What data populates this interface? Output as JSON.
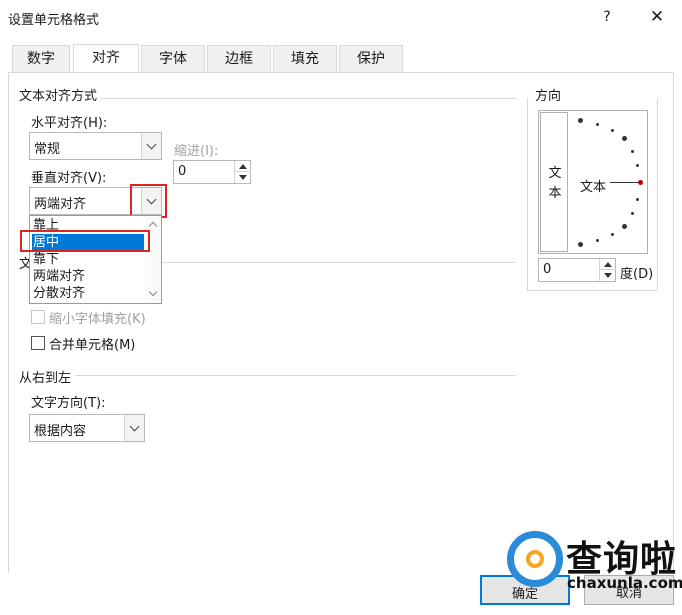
{
  "window": {
    "title": "设置单元格格式",
    "help": "?",
    "close": "✕"
  },
  "tabs": [
    {
      "label": "数字"
    },
    {
      "label": "对齐"
    },
    {
      "label": "字体"
    },
    {
      "label": "边框"
    },
    {
      "label": "填充"
    },
    {
      "label": "保护"
    }
  ],
  "active_tab": "对齐",
  "text_align": {
    "group_title": "文本对齐方式",
    "horizontal_label": "水平对齐(H):",
    "horizontal_value": "常规",
    "indent_label": "缩进(I):",
    "indent_value": "0",
    "vertical_label": "垂直对齐(V):",
    "vertical_value": "两端对齐",
    "vertical_options": [
      "靠上",
      "居中",
      "靠下",
      "两端对齐",
      "分散对齐"
    ],
    "vertical_highlighted": "居中"
  },
  "text_control": {
    "group_title_visible": "文",
    "shrink_label": "缩小字体填充(K)",
    "merge_label": "合并单元格(M)"
  },
  "rtl": {
    "group_title": "从右到左",
    "direction_label": "文字方向(T):",
    "direction_value": "根据内容"
  },
  "orientation": {
    "group_title": "方向",
    "vertical_text": "文\n本",
    "dial_text": "文本",
    "degree_value": "0",
    "degree_label": "度(D)"
  },
  "buttons": {
    "ok": "确定",
    "cancel": "取消"
  },
  "watermark": {
    "main": "查询啦",
    "sub": "chaxunla.com"
  },
  "colors": {
    "selection": "#0078d7",
    "highlight_box": "#d9281f",
    "watermark_ring": "#2a8bd9",
    "watermark_accent": "#f5a623"
  }
}
